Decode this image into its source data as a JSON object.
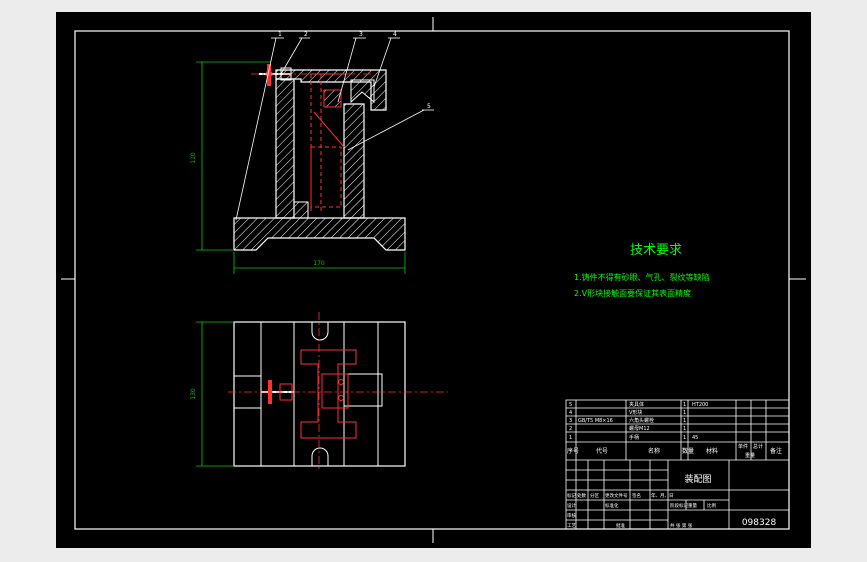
{
  "drawing": {
    "tech_title": "技术要求",
    "tech_notes": [
      "1.铸件不得有砂眼、气孔、裂纹等缺陷",
      "2.V形块接触面要保证其表面精度"
    ],
    "balloons": [
      "1",
      "2",
      "3",
      "4",
      "5"
    ],
    "dims": {
      "height_front": "110",
      "width_front": "170",
      "height_top": "130"
    }
  },
  "title_block": {
    "parts": [
      {
        "no": "5",
        "code": "",
        "name": "夹具体",
        "qty": "1",
        "material": "HT200"
      },
      {
        "no": "4",
        "code": "",
        "name": "V形块",
        "qty": "1",
        "material": ""
      },
      {
        "no": "3",
        "code": "GB/T5 M8×16",
        "name": "六角头螺栓",
        "qty": "1",
        "material": ""
      },
      {
        "no": "2",
        "code": "",
        "name": "螺母M12",
        "qty": "1",
        "material": ""
      },
      {
        "no": "1",
        "code": "",
        "name": "手柄",
        "qty": "1",
        "material": "45"
      }
    ],
    "headers": {
      "no": "序号",
      "code": "代号",
      "name": "名称",
      "qty": "数量",
      "material": "材料",
      "unit_weight": "单件",
      "total_weight": "总计",
      "weight": "重量",
      "remark": "备注"
    },
    "drawing_name": "装配图",
    "drawing_number": "098328",
    "labels": {
      "mark": "标记",
      "count": "处数",
      "zone": "分区",
      "change_doc": "更改文件号",
      "sign": "签名",
      "date": "年、月、日",
      "design": "设计",
      "standard": "标准化",
      "stage": "阶段标记",
      "weight": "重量",
      "scale": "比例",
      "review": "审核",
      "process": "工艺",
      "approve": "批准",
      "sheets": "共 张 第 张"
    }
  }
}
